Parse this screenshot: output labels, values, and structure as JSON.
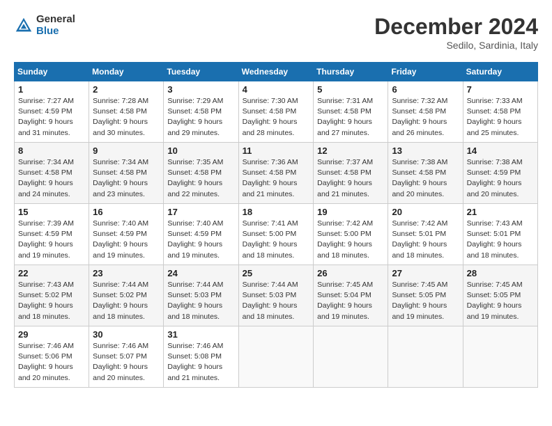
{
  "header": {
    "logo_general": "General",
    "logo_blue": "Blue",
    "month_title": "December 2024",
    "location": "Sedilo, Sardinia, Italy"
  },
  "weekdays": [
    "Sunday",
    "Monday",
    "Tuesday",
    "Wednesday",
    "Thursday",
    "Friday",
    "Saturday"
  ],
  "weeks": [
    [
      {
        "day": "1",
        "sunrise": "7:27 AM",
        "sunset": "4:59 PM",
        "daylight": "9 hours and 31 minutes."
      },
      {
        "day": "2",
        "sunrise": "7:28 AM",
        "sunset": "4:58 PM",
        "daylight": "9 hours and 30 minutes."
      },
      {
        "day": "3",
        "sunrise": "7:29 AM",
        "sunset": "4:58 PM",
        "daylight": "9 hours and 29 minutes."
      },
      {
        "day": "4",
        "sunrise": "7:30 AM",
        "sunset": "4:58 PM",
        "daylight": "9 hours and 28 minutes."
      },
      {
        "day": "5",
        "sunrise": "7:31 AM",
        "sunset": "4:58 PM",
        "daylight": "9 hours and 27 minutes."
      },
      {
        "day": "6",
        "sunrise": "7:32 AM",
        "sunset": "4:58 PM",
        "daylight": "9 hours and 26 minutes."
      },
      {
        "day": "7",
        "sunrise": "7:33 AM",
        "sunset": "4:58 PM",
        "daylight": "9 hours and 25 minutes."
      }
    ],
    [
      {
        "day": "8",
        "sunrise": "7:34 AM",
        "sunset": "4:58 PM",
        "daylight": "9 hours and 24 minutes."
      },
      {
        "day": "9",
        "sunrise": "7:34 AM",
        "sunset": "4:58 PM",
        "daylight": "9 hours and 23 minutes."
      },
      {
        "day": "10",
        "sunrise": "7:35 AM",
        "sunset": "4:58 PM",
        "daylight": "9 hours and 22 minutes."
      },
      {
        "day": "11",
        "sunrise": "7:36 AM",
        "sunset": "4:58 PM",
        "daylight": "9 hours and 21 minutes."
      },
      {
        "day": "12",
        "sunrise": "7:37 AM",
        "sunset": "4:58 PM",
        "daylight": "9 hours and 21 minutes."
      },
      {
        "day": "13",
        "sunrise": "7:38 AM",
        "sunset": "4:58 PM",
        "daylight": "9 hours and 20 minutes."
      },
      {
        "day": "14",
        "sunrise": "7:38 AM",
        "sunset": "4:59 PM",
        "daylight": "9 hours and 20 minutes."
      }
    ],
    [
      {
        "day": "15",
        "sunrise": "7:39 AM",
        "sunset": "4:59 PM",
        "daylight": "9 hours and 19 minutes."
      },
      {
        "day": "16",
        "sunrise": "7:40 AM",
        "sunset": "4:59 PM",
        "daylight": "9 hours and 19 minutes."
      },
      {
        "day": "17",
        "sunrise": "7:40 AM",
        "sunset": "4:59 PM",
        "daylight": "9 hours and 19 minutes."
      },
      {
        "day": "18",
        "sunrise": "7:41 AM",
        "sunset": "5:00 PM",
        "daylight": "9 hours and 18 minutes."
      },
      {
        "day": "19",
        "sunrise": "7:42 AM",
        "sunset": "5:00 PM",
        "daylight": "9 hours and 18 minutes."
      },
      {
        "day": "20",
        "sunrise": "7:42 AM",
        "sunset": "5:01 PM",
        "daylight": "9 hours and 18 minutes."
      },
      {
        "day": "21",
        "sunrise": "7:43 AM",
        "sunset": "5:01 PM",
        "daylight": "9 hours and 18 minutes."
      }
    ],
    [
      {
        "day": "22",
        "sunrise": "7:43 AM",
        "sunset": "5:02 PM",
        "daylight": "9 hours and 18 minutes."
      },
      {
        "day": "23",
        "sunrise": "7:44 AM",
        "sunset": "5:02 PM",
        "daylight": "9 hours and 18 minutes."
      },
      {
        "day": "24",
        "sunrise": "7:44 AM",
        "sunset": "5:03 PM",
        "daylight": "9 hours and 18 minutes."
      },
      {
        "day": "25",
        "sunrise": "7:44 AM",
        "sunset": "5:03 PM",
        "daylight": "9 hours and 18 minutes."
      },
      {
        "day": "26",
        "sunrise": "7:45 AM",
        "sunset": "5:04 PM",
        "daylight": "9 hours and 19 minutes."
      },
      {
        "day": "27",
        "sunrise": "7:45 AM",
        "sunset": "5:05 PM",
        "daylight": "9 hours and 19 minutes."
      },
      {
        "day": "28",
        "sunrise": "7:45 AM",
        "sunset": "5:05 PM",
        "daylight": "9 hours and 19 minutes."
      }
    ],
    [
      {
        "day": "29",
        "sunrise": "7:46 AM",
        "sunset": "5:06 PM",
        "daylight": "9 hours and 20 minutes."
      },
      {
        "day": "30",
        "sunrise": "7:46 AM",
        "sunset": "5:07 PM",
        "daylight": "9 hours and 20 minutes."
      },
      {
        "day": "31",
        "sunrise": "7:46 AM",
        "sunset": "5:08 PM",
        "daylight": "9 hours and 21 minutes."
      },
      null,
      null,
      null,
      null
    ]
  ]
}
